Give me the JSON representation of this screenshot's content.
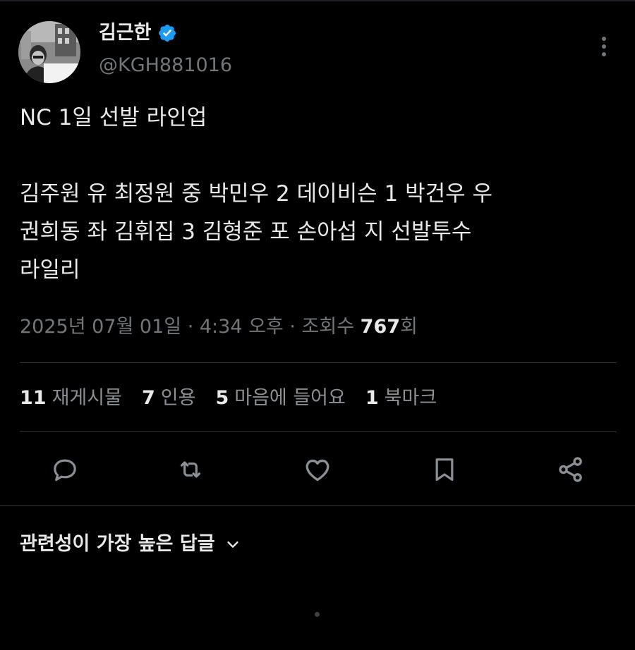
{
  "author": {
    "display_name": "김근한",
    "handle": "@KGH881016",
    "verified_icon": "verified-badge-icon",
    "avatar_icon": "avatar"
  },
  "tweet": {
    "lines": [
      "NC 1일 선발 라인업",
      "",
      "김주원 유 최정원 중 박민우 2 데이비슨 1 박건우 우",
      "권희동 좌 김휘집 3 김형준 포 손아섭 지 선발투수",
      "라일리"
    ]
  },
  "meta": {
    "date": "2025년 07월 01일",
    "separator": " · ",
    "time": "4:34 오후",
    "views_label": "조회수",
    "views_count": "767",
    "views_suffix": "회"
  },
  "stats": [
    {
      "count": "11",
      "label": "재게시물"
    },
    {
      "count": "7",
      "label": "인용"
    },
    {
      "count": "5",
      "label": "마음에 들어요"
    },
    {
      "count": "1",
      "label": "북마크"
    }
  ],
  "actions": [
    "reply-icon",
    "retweet-icon",
    "like-icon",
    "bookmark-icon",
    "share-icon"
  ],
  "replies": {
    "sort_label": "관련성이 가장 높은 답글"
  },
  "colors": {
    "background": "#000000",
    "text_primary": "#e7e9ea",
    "text_secondary": "#71767b",
    "divider": "#2f3336",
    "verified": "#1d9bf0"
  }
}
